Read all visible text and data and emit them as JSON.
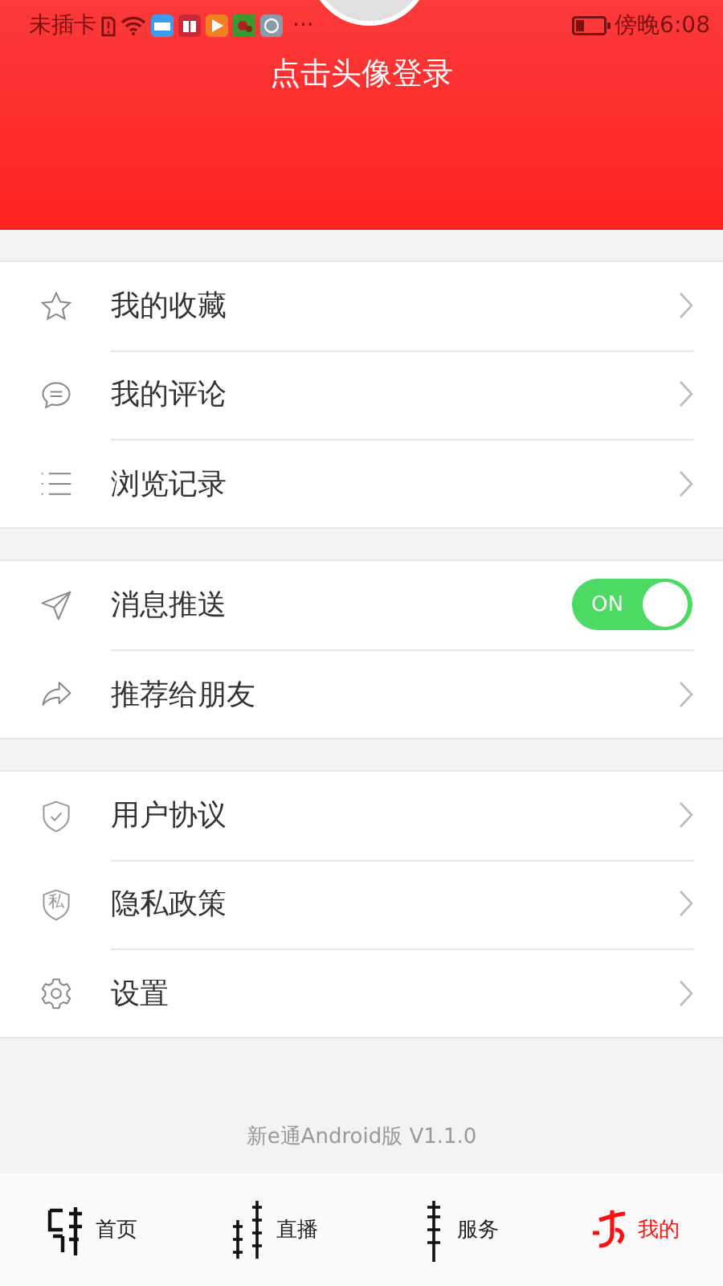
{
  "status_bar": {
    "carrier": "未插卡",
    "more": "···",
    "time": "傍晚6:08"
  },
  "header": {
    "login_prompt": "点击头像登录"
  },
  "sections": [
    {
      "items": [
        {
          "kind": "link",
          "label": "我的收藏"
        },
        {
          "kind": "link",
          "label": "我的评论"
        },
        {
          "kind": "link",
          "label": "浏览记录"
        }
      ]
    },
    {
      "items": [
        {
          "kind": "toggle",
          "label": "消息推送",
          "on": true,
          "switch_text": "ON"
        },
        {
          "kind": "link",
          "label": "推荐给朋友"
        }
      ]
    },
    {
      "items": [
        {
          "kind": "link",
          "label": "用户协议"
        },
        {
          "kind": "link",
          "label": "隐私政策",
          "icon_text": "私"
        },
        {
          "kind": "link",
          "label": "设置"
        }
      ]
    }
  ],
  "version": "新e通Android版 V1.1.0",
  "tabs": [
    {
      "label": "首页",
      "selected": false
    },
    {
      "label": "直播",
      "selected": false
    },
    {
      "label": "服务",
      "selected": false
    },
    {
      "label": "我的",
      "selected": true
    }
  ]
}
